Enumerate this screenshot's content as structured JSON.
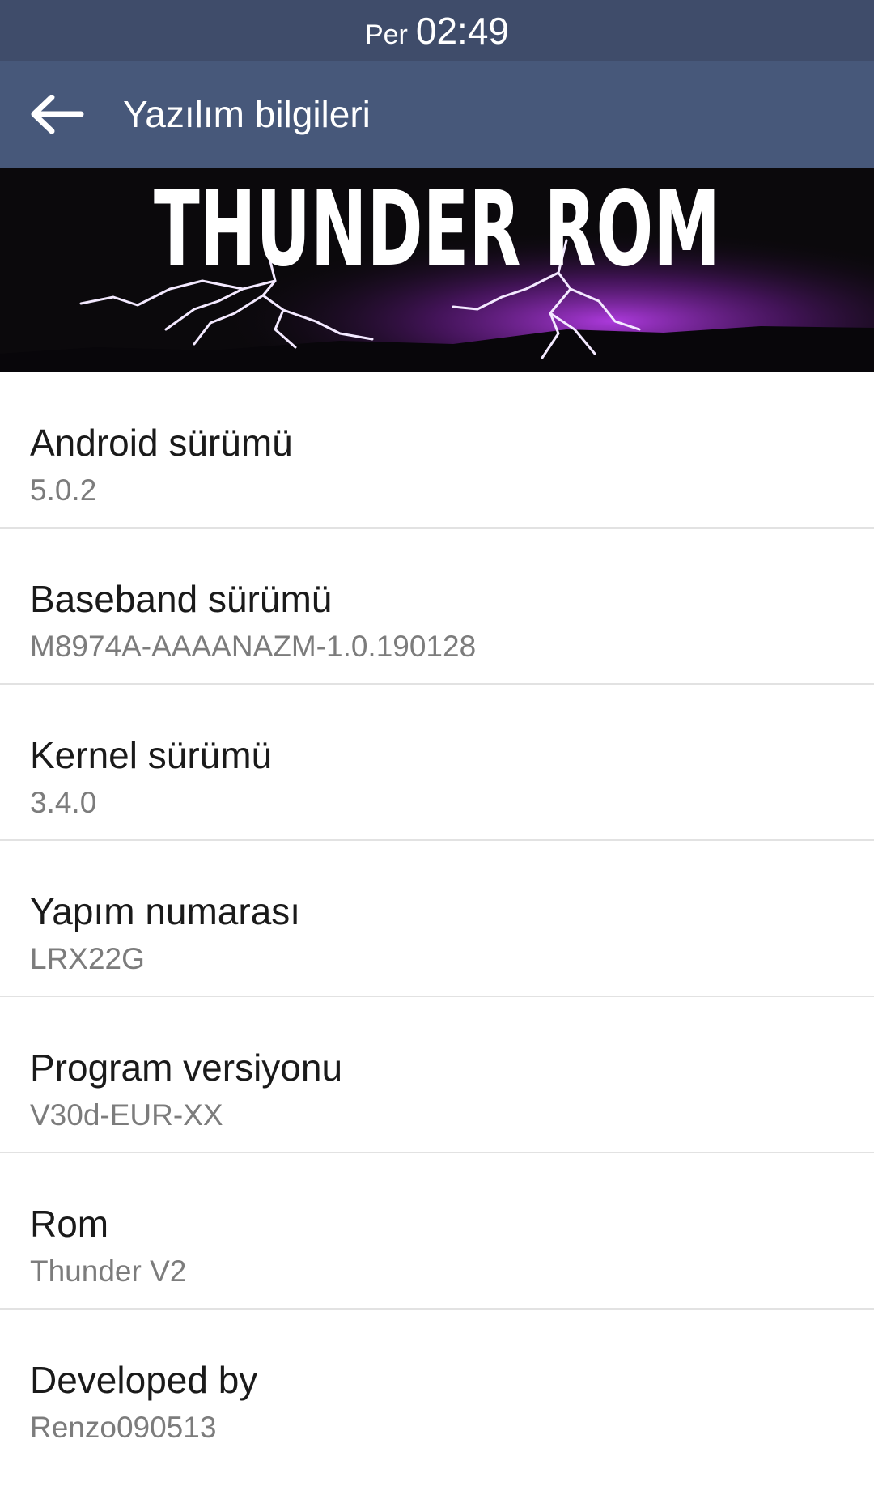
{
  "status_bar": {
    "day": "Per",
    "time": "02:49"
  },
  "app_bar": {
    "back_icon": "arrow-left-icon",
    "title": "Yazılım bilgileri"
  },
  "banner": {
    "text": "THUNDER ROM"
  },
  "items": [
    {
      "title": "Android sürümü",
      "value": "5.0.2"
    },
    {
      "title": "Baseband sürümü",
      "value": "M8974A-AAAANAZM-1.0.190128"
    },
    {
      "title": "Kernel sürümü",
      "value": "3.4.0"
    },
    {
      "title": "Yapım numarası",
      "value": "LRX22G"
    },
    {
      "title": "Program versiyonu",
      "value": "V30d-EUR-XX"
    },
    {
      "title": "Rom",
      "value": "Thunder V2"
    },
    {
      "title": "Developed by",
      "value": "Renzo090513"
    }
  ],
  "colors": {
    "status_bar": "#3f4c6a",
    "app_bar": "#47587a",
    "banner_bg": "#0b090c",
    "lightning_accent": "#a02ad0"
  }
}
